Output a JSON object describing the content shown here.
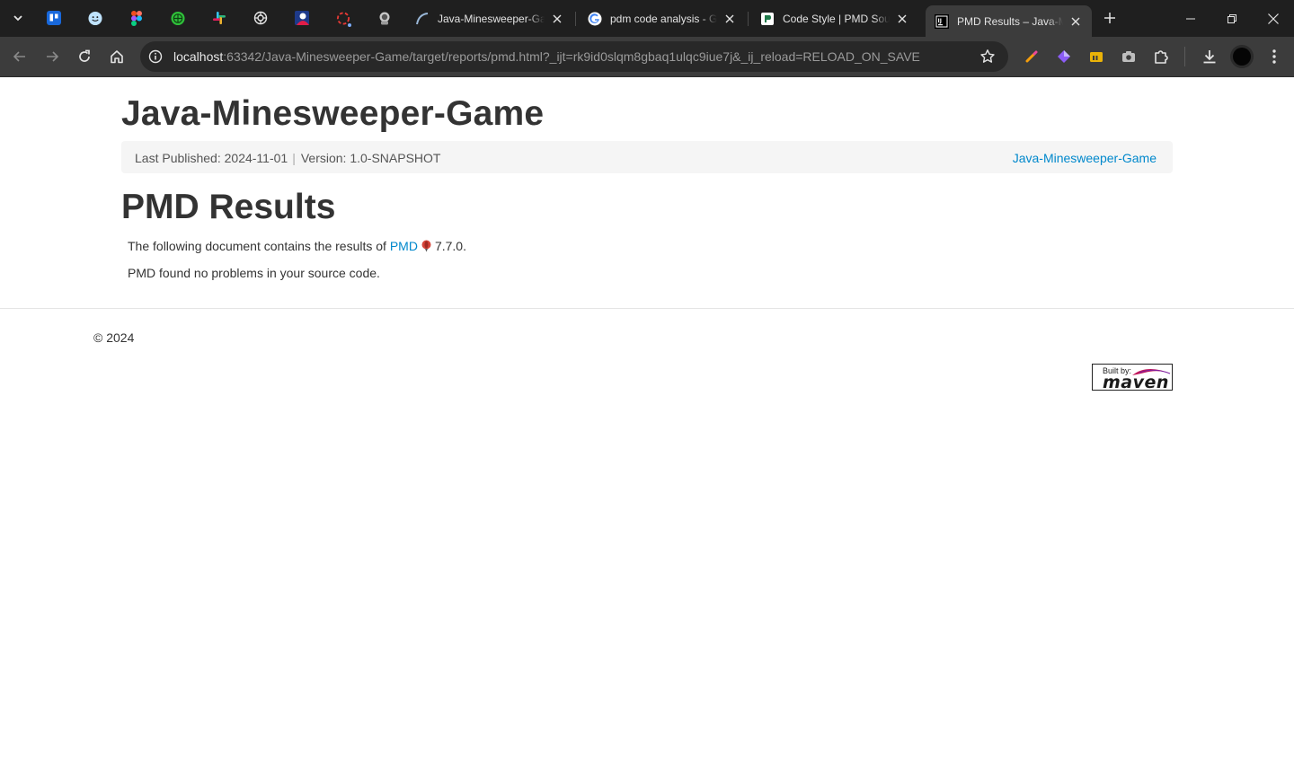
{
  "browser": {
    "tabs": [
      {
        "title": "Java-Minesweeper-Game"
      },
      {
        "title": "pdm code analysis - Google Search"
      },
      {
        "title": "Code Style | PMD Source Code Analyzer"
      },
      {
        "title": "PMD Results – Java-Minesweeper-Game",
        "active": true
      }
    ],
    "pinned_icons": [
      "trello-icon",
      "smiley-icon",
      "figma-icon",
      "globe-icon",
      "slack-icon",
      "openai-icon",
      "profile-icon",
      "loader-icon",
      "astronaut-icon"
    ],
    "url": {
      "host": "localhost",
      "rest": ":63342/Java-Minesweeper-Game/target/reports/pmd.html?_ijt=rk9id0slqm8gbaq1ulqc9iue7j&_ij_reload=RELOAD_ON_SAVE"
    },
    "colors": {
      "tabstrip": "#1f1f1f",
      "toolbar": "#3c3c3c",
      "omnibox": "#282828"
    }
  },
  "page": {
    "title": "Java-Minesweeper-Game",
    "breadcrumbs": {
      "published": "Last Published: 2024-11-01",
      "divider": "|",
      "version": "Version: 1.0-SNAPSHOT",
      "project_link": "Java-Minesweeper-Game"
    },
    "section_title": "PMD Results",
    "intro_prefix": "The following document contains the results of",
    "pmd_link": "PMD",
    "pmd_version": "7.7.0.",
    "result": "PMD found no problems in your source code.",
    "copyright": "© 2024",
    "maven_badge": {
      "built": "Built by:",
      "word": "maven"
    },
    "colors": {
      "link": "#0088cc",
      "text": "#333333",
      "breadcrumb_bg": "#f5f5f5"
    }
  }
}
